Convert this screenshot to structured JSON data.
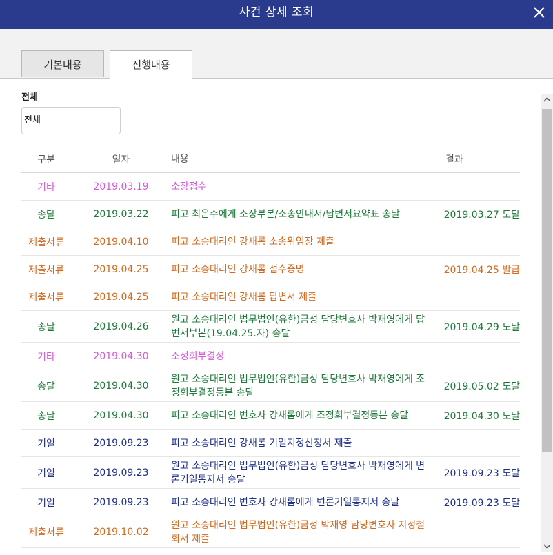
{
  "window": {
    "title": "사건 상세 조회",
    "close_icon": "close-icon"
  },
  "tabs": [
    {
      "label": "기본내용",
      "active": false
    },
    {
      "label": "진행내용",
      "active": true
    }
  ],
  "filter": {
    "label": "전체",
    "value": "전체"
  },
  "table": {
    "headers": [
      "구분",
      "일자",
      "내용",
      "결과"
    ],
    "rows": [
      {
        "category": "기타",
        "date": "2019.03.19",
        "content": "소장접수",
        "result": "",
        "color": "#d65ad6"
      },
      {
        "category": "송달",
        "date": "2019.03.22",
        "content": "피고 최은주에게 소장부본/소송안내서/답변서요약표 송달",
        "result": "2019.03.27 도달",
        "color": "#1e7a3a"
      },
      {
        "category": "제출서류",
        "date": "2019.04.10",
        "content": "피고 소송대리인 강새롬 소송위임장 제출",
        "result": "",
        "color": "#d2691e"
      },
      {
        "category": "제출서류",
        "date": "2019.04.25",
        "content": "피고 소송대리인 강새롬 접수증명",
        "result": "2019.04.25 발급",
        "color": "#d2691e"
      },
      {
        "category": "제출서류",
        "date": "2019.04.25",
        "content": "피고 소송대리인 강새롬 답변서 제출",
        "result": "",
        "color": "#d2691e"
      },
      {
        "category": "송달",
        "date": "2019.04.26",
        "content": "원고 소송대리인 법무법인(유한)금성 담당변호사 박재영에게 답변서부본(19.04.25.자) 송달",
        "result": "2019.04.29 도달",
        "color": "#1e7a3a"
      },
      {
        "category": "기타",
        "date": "2019.04.30",
        "content": "조정회부결정",
        "result": "",
        "color": "#d65ad6"
      },
      {
        "category": "송달",
        "date": "2019.04.30",
        "content": "원고 소송대리인 법무법인(유한)금성 담당변호사 박재영에게 조정회부결정등본 송달",
        "result": "2019.05.02 도달",
        "color": "#1e7a3a"
      },
      {
        "category": "송달",
        "date": "2019.04.30",
        "content": "피고 소송대리인 변호사 강새롬에게 조정회부결정등본 송달",
        "result": "2019.04.30 도달",
        "color": "#1e7a3a"
      },
      {
        "category": "기일",
        "date": "2019.09.23",
        "content": "피고 소송대리인 강새롬 기일지정신청서 제출",
        "result": "",
        "color": "#1f2f8a"
      },
      {
        "category": "기일",
        "date": "2019.09.23",
        "content": "원고 소송대리인 법무법인(유한)금성 담당변호사 박재영에게 변론기일통지서 송달",
        "result": "2019.09.23 도달",
        "color": "#1f2f8a"
      },
      {
        "category": "기일",
        "date": "2019.09.23",
        "content": "피고 소송대리인 변호사 강새롬에게 변론기일통지서 송달",
        "result": "2019.09.23 도달",
        "color": "#1f2f8a"
      },
      {
        "category": "제출서류",
        "date": "2019.10.02",
        "content": "원고 소송대리인 법무법인(유한)금성 박재영 담당변호사 지정철회서 제출",
        "result": "",
        "color": "#d2691e"
      }
    ]
  }
}
